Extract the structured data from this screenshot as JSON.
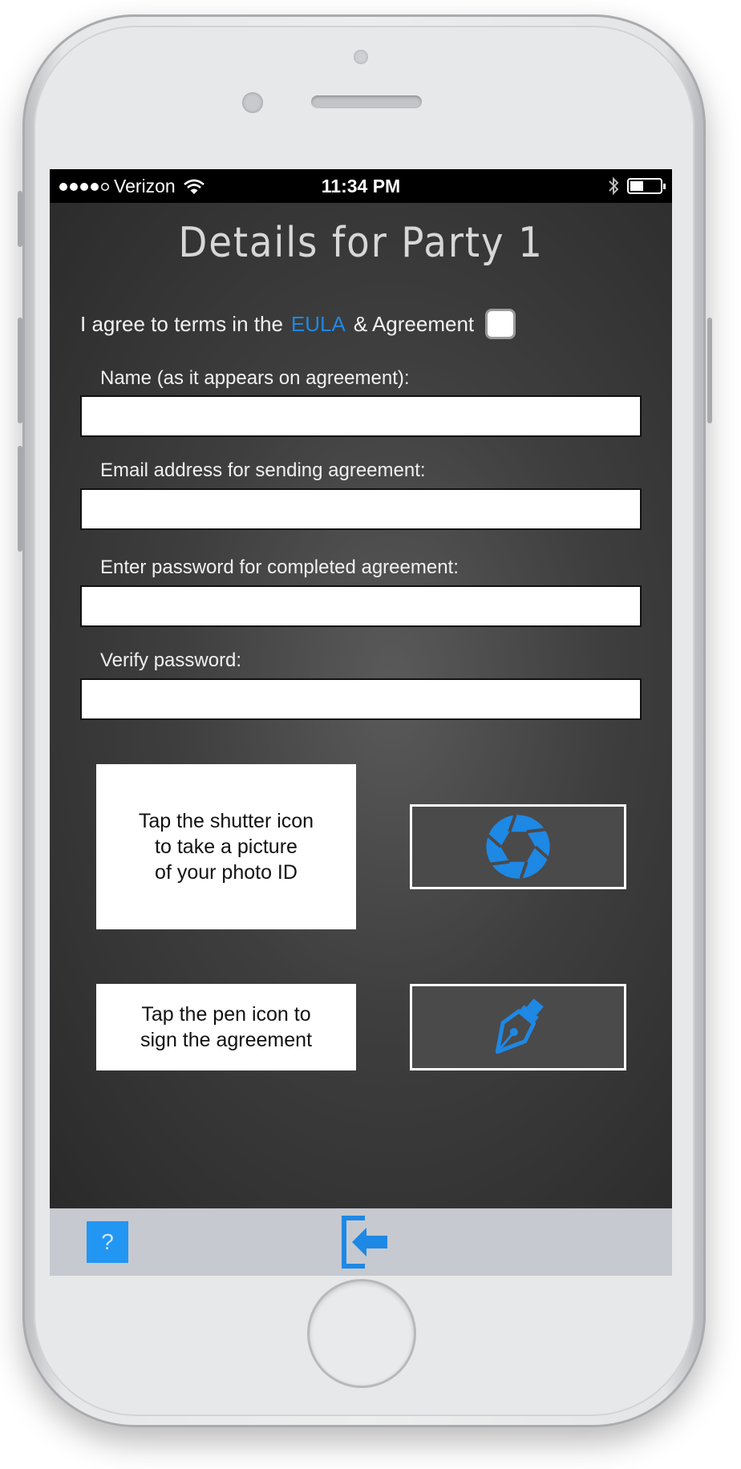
{
  "status_bar": {
    "carrier": "Verizon",
    "time": "11:34 PM",
    "signal_bars_filled": 4,
    "signal_bars_total": 5,
    "battery_level": 0.4
  },
  "page": {
    "title": "Details for Party 1"
  },
  "agreement": {
    "text_before": "I agree to terms in the",
    "link": "EULA",
    "text_after": "& Agreement",
    "checked": false
  },
  "form": {
    "name_label": "Name (as it appears on agreement):",
    "name_value": "",
    "email_label": "Email address for sending agreement:",
    "email_value": "",
    "password_label": "Enter password for completed agreement:",
    "password_value": "",
    "verify_label": "Verify password:",
    "verify_value": ""
  },
  "photo_section": {
    "line1": "Tap the shutter icon",
    "line2": "to take a picture",
    "line3": "of your photo ID",
    "icon": "shutter-icon"
  },
  "sign_section": {
    "line1": "Tap the pen icon to",
    "line2": "sign the agreement",
    "icon": "pen-icon"
  },
  "toolbar": {
    "help_label": "?",
    "exit_icon": "exit-icon"
  },
  "colors": {
    "accent_blue": "#1e88e5",
    "background": "#3e3e3e",
    "toolbar": "#c6c9cf"
  }
}
